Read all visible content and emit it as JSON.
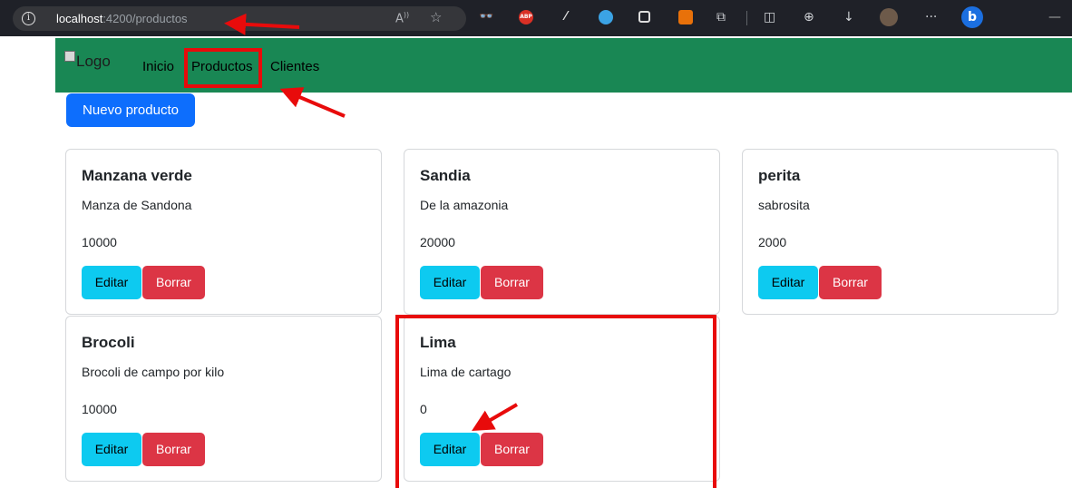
{
  "browser": {
    "url_host": "localhost",
    "url_path": ":4200/productos",
    "bing_label": "b",
    "extensions": [
      "glasses-icon",
      "adblock-icon",
      "eyedropper-icon",
      "cloud-icon",
      "screen-icon",
      "cast-icon"
    ],
    "adblock_label": "ABP",
    "more_label": "···",
    "minimize_label": "—"
  },
  "navbar": {
    "logo_alt": "Logo",
    "links": [
      "Inicio",
      "Productos",
      "Clientes"
    ],
    "color": "#198754"
  },
  "actions": {
    "new_product_label": "Nuevo producto"
  },
  "products": [
    {
      "name": "Manzana verde",
      "description": "Manza de Sandona",
      "price": "10000"
    },
    {
      "name": "Sandia",
      "description": "De la amazonia",
      "price": "20000"
    },
    {
      "name": "perita",
      "description": "sabrosita",
      "price": "2000"
    },
    {
      "name": "Brocoli",
      "description": "Brocoli de campo por kilo",
      "price": "10000"
    },
    {
      "name": "Lima",
      "description": "Lima de cartago",
      "price": "0"
    }
  ],
  "card_buttons": {
    "edit_label": "Editar",
    "delete_label": "Borrar"
  },
  "colors": {
    "primary": "#0d6efd",
    "info": "#0dcaf0",
    "danger": "#dc3545",
    "annotation": "#e80b0b"
  }
}
